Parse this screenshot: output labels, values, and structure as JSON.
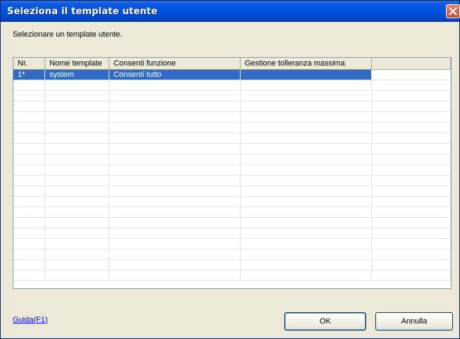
{
  "window": {
    "title": "Seleziona il template utente"
  },
  "instruction": "Selezionare un template utente.",
  "table": {
    "columns": [
      "Nr.",
      "Nome template",
      "Consenti funzione",
      "Gestione tolleranza massima"
    ],
    "rows": [
      {
        "nr": "1*",
        "name": "system",
        "permission": "Consenti tutto",
        "tolerance": "",
        "selected": true
      }
    ]
  },
  "help_link": "Guida(F1)",
  "buttons": {
    "ok": "OK",
    "cancel": "Annulla"
  },
  "colors": {
    "titlebar": "#0054e3",
    "selection": "#316ac5",
    "dialog_bg": "#ece9d8"
  }
}
